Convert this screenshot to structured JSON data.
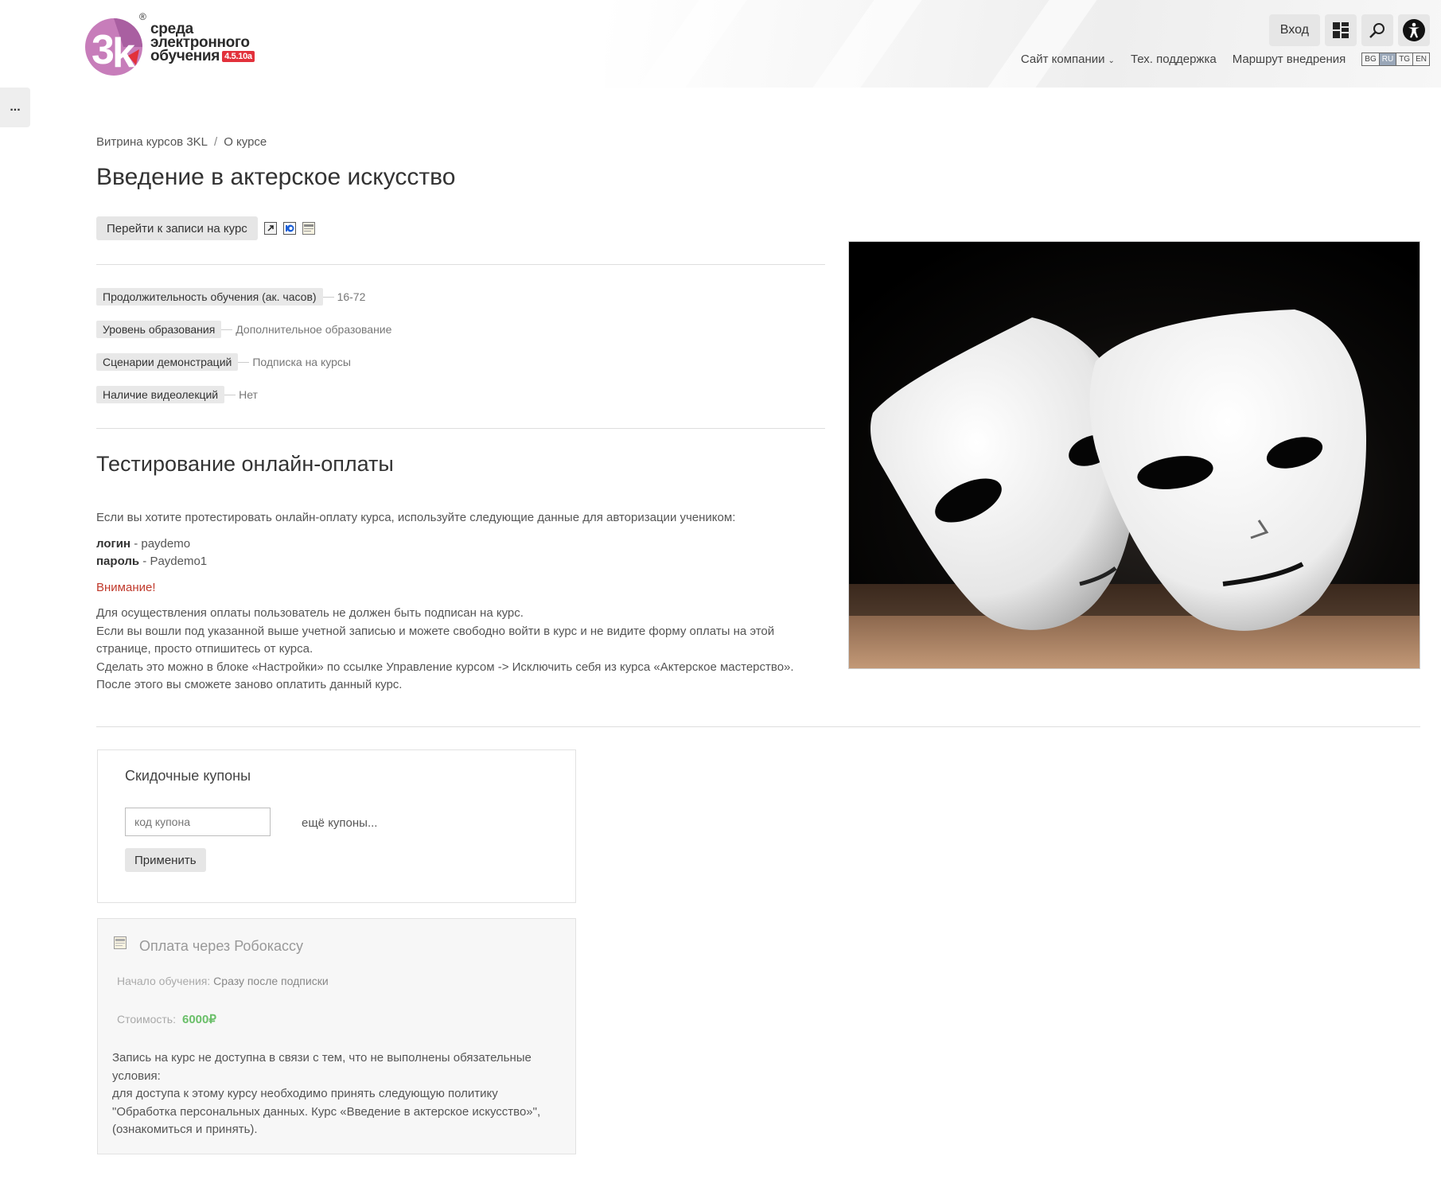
{
  "logo": {
    "line1": "среда",
    "line2": "электронного",
    "line3": "обучения",
    "version": "4.5.10a",
    "reg": "®"
  },
  "top_buttons": {
    "login_label": "Вход"
  },
  "top_nav": {
    "items": [
      "Сайт компании",
      "Тех. поддержка",
      "Маршрут внедрения"
    ],
    "languages": [
      "BG",
      "RU",
      "TG",
      "EN"
    ],
    "active_language": "RU"
  },
  "side_tab": {
    "label": "..."
  },
  "breadcrumb": [
    "Витрина курсов 3KL",
    "О курсе"
  ],
  "page": {
    "title": "Введение в актерское искусство"
  },
  "enroll": {
    "label": "Перейти к записи на курс"
  },
  "properties": [
    {
      "label": "Продолжительность обучения (ак. часов)",
      "value": "16-72"
    },
    {
      "label": "Уровень образования",
      "value": "Дополнительное образование"
    },
    {
      "label": "Сценарии демонстраций",
      "value": "Подписка на курсы"
    },
    {
      "label": "Наличие видеолекций",
      "value": "Нет"
    }
  ],
  "testing": {
    "title": "Тестирование онлайн-оплаты",
    "intro": "Если вы хотите протестировать онлайн-оплату курса, используйте следующие данные для авторизации учеником:",
    "login_key": "логин",
    "login_val": " - paydemo",
    "password_key": "пароль",
    "password_val": " - Paydemo1",
    "warning": "Внимание!",
    "line1": "Для осуществления оплаты пользователь не должен быть подписан на курс.",
    "line2": "Если вы вошли под указанной выше учетной записью и можете свободно войти в курс и не видите форму оплаты на этой странице, просто отпишитесь от курса.",
    "line3": "Сделать это можно в блоке «Настройки» по ссылке Управление курсом -> Исключить себя из курса «Актерское мастерство».",
    "line4": "После этого вы сможете заново оплатить данный курс."
  },
  "coupons": {
    "title": "Скидочные купоны",
    "placeholder": "код купона",
    "more": "ещё купоны...",
    "apply": "Применить"
  },
  "payment": {
    "title": "Оплата через Робокассу",
    "start_key": "Начало обучения:",
    "start_val": "Сразу после подписки",
    "cost_key": "Стоимость:",
    "price": "6000₽",
    "note_line1": "Запись на курс не доступна в связи с тем, что не выполнены обязательные условия:",
    "note_line2": "для доступа к этому курсу необходимо принять следующую политику \"Обработка персональных данных. Курс «Введение в актерское искусство»\", (ознакомиться и принять)."
  },
  "colors": {
    "accent_red": "#e2313b",
    "warning_red": "#c0392b",
    "price_green": "#6abf69",
    "button_gray": "#e6e6e6",
    "active_lang": "#9aa7b8"
  },
  "icons": [
    "logo-3k-icon",
    "dashboard-icon",
    "search-icon",
    "accessibility-icon",
    "chevron-down-icon",
    "external-link-icon",
    "yoomoney-icon",
    "card-payment-icon",
    "more-icon",
    "theatre-masks-image"
  ]
}
